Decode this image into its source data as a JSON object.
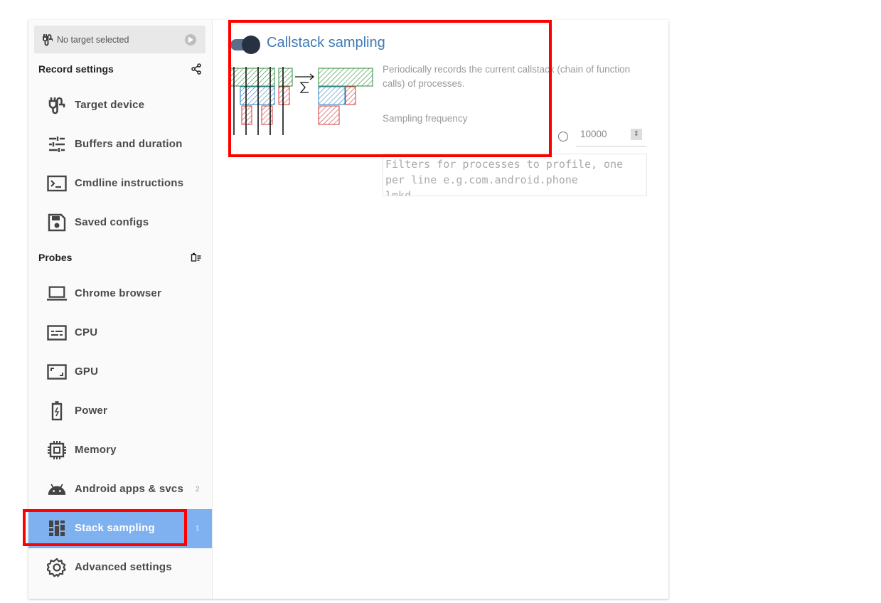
{
  "target": {
    "label": "No target selected",
    "icon": "cable-icon",
    "action_icon": "play-icon"
  },
  "sections": {
    "record_settings": {
      "title": "Record settings",
      "icon": "share-icon"
    },
    "probes": {
      "title": "Probes",
      "icon": "clear-all-icon"
    }
  },
  "nav": {
    "record": [
      {
        "label": "Target device",
        "icon": "cable-icon"
      },
      {
        "label": "Buffers and duration",
        "icon": "sliders-icon"
      },
      {
        "label": "Cmdline instructions",
        "icon": "terminal-icon"
      },
      {
        "label": "Saved configs",
        "icon": "save-icon"
      }
    ],
    "probes": [
      {
        "label": "Chrome browser",
        "icon": "laptop-icon",
        "count": ""
      },
      {
        "label": "CPU",
        "icon": "cpu-subtitles-icon",
        "count": ""
      },
      {
        "label": "GPU",
        "icon": "gpu-frame-icon",
        "count": ""
      },
      {
        "label": "Power",
        "icon": "battery-icon",
        "count": ""
      },
      {
        "label": "Memory",
        "icon": "memory-chip-icon",
        "count": ""
      },
      {
        "label": "Android apps & svcs",
        "icon": "android-icon",
        "count": "2"
      },
      {
        "label": "Stack sampling",
        "icon": "stack-bars-icon",
        "count": "1",
        "active": true
      },
      {
        "label": "Advanced settings",
        "icon": "gear-icon",
        "count": ""
      }
    ]
  },
  "probe": {
    "title": "Callstack sampling",
    "enabled": true,
    "description": "Periodically records the current callstack (chain of function calls) of processes.",
    "frequency_label": "Sampling frequency",
    "frequency_value": "10000",
    "filter_placeholder": "Filters for processes to profile, one per line e.g.com.android.phone\nlmkd",
    "illustration": "callstack-flamegraph-illustration"
  },
  "colors": {
    "accent": "#3f7ab5",
    "active_nav": "#7fb0ef",
    "highlight": "#ff0000",
    "flame_green": "#2e8b3a",
    "flame_blue": "#2f7fc0",
    "flame_red": "#d23a3a"
  }
}
